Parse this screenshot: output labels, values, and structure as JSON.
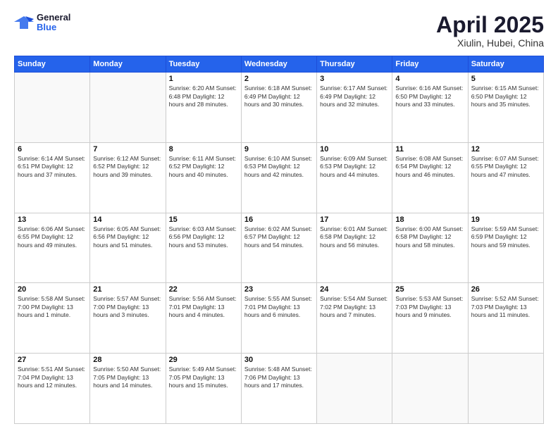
{
  "header": {
    "logo": {
      "general": "General",
      "blue": "Blue"
    },
    "title": "April 2025",
    "location": "Xiulin, Hubei, China"
  },
  "weekdays": [
    "Sunday",
    "Monday",
    "Tuesday",
    "Wednesday",
    "Thursday",
    "Friday",
    "Saturday"
  ],
  "weeks": [
    [
      {
        "day": "",
        "info": ""
      },
      {
        "day": "",
        "info": ""
      },
      {
        "day": "1",
        "info": "Sunrise: 6:20 AM\nSunset: 6:48 PM\nDaylight: 12 hours\nand 28 minutes."
      },
      {
        "day": "2",
        "info": "Sunrise: 6:18 AM\nSunset: 6:49 PM\nDaylight: 12 hours\nand 30 minutes."
      },
      {
        "day": "3",
        "info": "Sunrise: 6:17 AM\nSunset: 6:49 PM\nDaylight: 12 hours\nand 32 minutes."
      },
      {
        "day": "4",
        "info": "Sunrise: 6:16 AM\nSunset: 6:50 PM\nDaylight: 12 hours\nand 33 minutes."
      },
      {
        "day": "5",
        "info": "Sunrise: 6:15 AM\nSunset: 6:50 PM\nDaylight: 12 hours\nand 35 minutes."
      }
    ],
    [
      {
        "day": "6",
        "info": "Sunrise: 6:14 AM\nSunset: 6:51 PM\nDaylight: 12 hours\nand 37 minutes."
      },
      {
        "day": "7",
        "info": "Sunrise: 6:12 AM\nSunset: 6:52 PM\nDaylight: 12 hours\nand 39 minutes."
      },
      {
        "day": "8",
        "info": "Sunrise: 6:11 AM\nSunset: 6:52 PM\nDaylight: 12 hours\nand 40 minutes."
      },
      {
        "day": "9",
        "info": "Sunrise: 6:10 AM\nSunset: 6:53 PM\nDaylight: 12 hours\nand 42 minutes."
      },
      {
        "day": "10",
        "info": "Sunrise: 6:09 AM\nSunset: 6:53 PM\nDaylight: 12 hours\nand 44 minutes."
      },
      {
        "day": "11",
        "info": "Sunrise: 6:08 AM\nSunset: 6:54 PM\nDaylight: 12 hours\nand 46 minutes."
      },
      {
        "day": "12",
        "info": "Sunrise: 6:07 AM\nSunset: 6:55 PM\nDaylight: 12 hours\nand 47 minutes."
      }
    ],
    [
      {
        "day": "13",
        "info": "Sunrise: 6:06 AM\nSunset: 6:55 PM\nDaylight: 12 hours\nand 49 minutes."
      },
      {
        "day": "14",
        "info": "Sunrise: 6:05 AM\nSunset: 6:56 PM\nDaylight: 12 hours\nand 51 minutes."
      },
      {
        "day": "15",
        "info": "Sunrise: 6:03 AM\nSunset: 6:56 PM\nDaylight: 12 hours\nand 53 minutes."
      },
      {
        "day": "16",
        "info": "Sunrise: 6:02 AM\nSunset: 6:57 PM\nDaylight: 12 hours\nand 54 minutes."
      },
      {
        "day": "17",
        "info": "Sunrise: 6:01 AM\nSunset: 6:58 PM\nDaylight: 12 hours\nand 56 minutes."
      },
      {
        "day": "18",
        "info": "Sunrise: 6:00 AM\nSunset: 6:58 PM\nDaylight: 12 hours\nand 58 minutes."
      },
      {
        "day": "19",
        "info": "Sunrise: 5:59 AM\nSunset: 6:59 PM\nDaylight: 12 hours\nand 59 minutes."
      }
    ],
    [
      {
        "day": "20",
        "info": "Sunrise: 5:58 AM\nSunset: 7:00 PM\nDaylight: 13 hours\nand 1 minute."
      },
      {
        "day": "21",
        "info": "Sunrise: 5:57 AM\nSunset: 7:00 PM\nDaylight: 13 hours\nand 3 minutes."
      },
      {
        "day": "22",
        "info": "Sunrise: 5:56 AM\nSunset: 7:01 PM\nDaylight: 13 hours\nand 4 minutes."
      },
      {
        "day": "23",
        "info": "Sunrise: 5:55 AM\nSunset: 7:01 PM\nDaylight: 13 hours\nand 6 minutes."
      },
      {
        "day": "24",
        "info": "Sunrise: 5:54 AM\nSunset: 7:02 PM\nDaylight: 13 hours\nand 7 minutes."
      },
      {
        "day": "25",
        "info": "Sunrise: 5:53 AM\nSunset: 7:03 PM\nDaylight: 13 hours\nand 9 minutes."
      },
      {
        "day": "26",
        "info": "Sunrise: 5:52 AM\nSunset: 7:03 PM\nDaylight: 13 hours\nand 11 minutes."
      }
    ],
    [
      {
        "day": "27",
        "info": "Sunrise: 5:51 AM\nSunset: 7:04 PM\nDaylight: 13 hours\nand 12 minutes."
      },
      {
        "day": "28",
        "info": "Sunrise: 5:50 AM\nSunset: 7:05 PM\nDaylight: 13 hours\nand 14 minutes."
      },
      {
        "day": "29",
        "info": "Sunrise: 5:49 AM\nSunset: 7:05 PM\nDaylight: 13 hours\nand 15 minutes."
      },
      {
        "day": "30",
        "info": "Sunrise: 5:48 AM\nSunset: 7:06 PM\nDaylight: 13 hours\nand 17 minutes."
      },
      {
        "day": "",
        "info": ""
      },
      {
        "day": "",
        "info": ""
      },
      {
        "day": "",
        "info": ""
      }
    ]
  ]
}
